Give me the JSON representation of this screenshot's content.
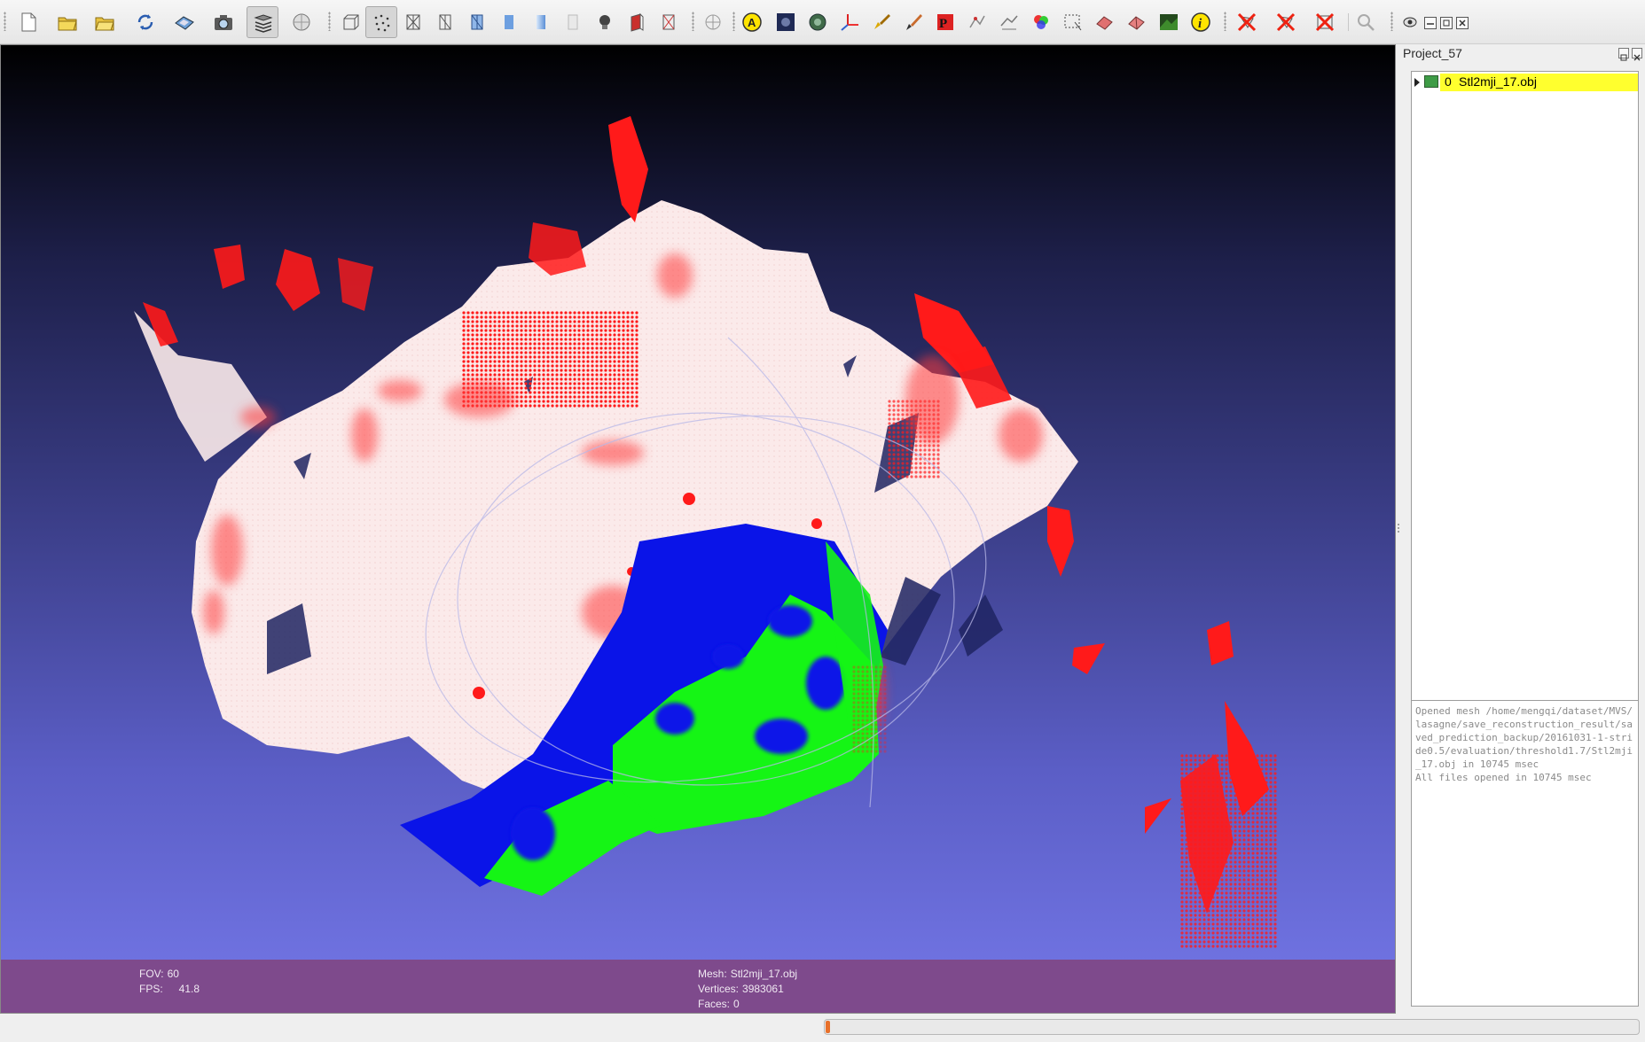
{
  "toolbar": {
    "groups": [
      [
        "new-file-icon",
        "open-project-icon",
        "open-mesh-icon",
        "reload-icon",
        "save-icon",
        "snapshot-icon",
        "layers-icon",
        "lights-icon"
      ],
      [
        "bounding-box-icon",
        "points-icon",
        "wireframe-icon",
        "hidden-lines-icon",
        "flat-lines-icon",
        "flat-icon",
        "smooth-icon",
        "texture-icon",
        "light-bulb-icon",
        "backface-icon",
        "double-side-icon"
      ],
      [
        "trackball-icon"
      ],
      [
        "annotation-icon",
        "texture-paint-icon",
        "sphere-shading-icon",
        "axes-icon",
        "color-brush-icon",
        "paint-brush-icon",
        "measure-icon",
        "pick-points-icon",
        "align-icon",
        "rgb-icon",
        "selection-icon",
        "select-faces-icon",
        "select-connected-icon",
        "raster-icon",
        "info-icon"
      ],
      [
        "delete-selected-faces-icon",
        "delete-selected-vertices-icon",
        "delete-all-icon"
      ],
      [
        "search-icon"
      ],
      [
        "eye-icon",
        "window-minimize-icon",
        "window-restore-icon",
        "window-close-icon"
      ]
    ],
    "active": "layers-icon"
  },
  "viewport": {
    "background_top": "#000000",
    "background_bottom": "#7477e7",
    "hud": {
      "fov_label": "FOV:",
      "fov_value": "60",
      "fps_label": "FPS:",
      "fps_value": "41.8",
      "mesh_label": "Mesh:",
      "mesh_value": "Stl2mji_17.obj",
      "vertices_label": "Vertices:",
      "vertices_value": "3983061",
      "faces_label": "Faces:",
      "faces_value": "0"
    },
    "colors": {
      "mesh_white": "#fbeaea",
      "outlier_red": "#ff1a1a",
      "region_blue": "#0a14e8",
      "region_green": "#15f515",
      "hud_bg": "#7e4a8c"
    }
  },
  "panel": {
    "title": "Project_57",
    "layers": [
      {
        "index": "0",
        "name": "Stl2mji_17.obj",
        "selected": true
      }
    ],
    "log": [
      "Opened mesh /home/mengqi/dataset/MVS/lasagne/save_reconstruction_result/saved_prediction_backup/20161031-1-stride0.5/evaluation/threshold1.7/Stl2mji_17.obj in 10745 msec",
      "All files opened in 10745 msec"
    ]
  },
  "statusbar": {
    "progress": 0.005
  }
}
